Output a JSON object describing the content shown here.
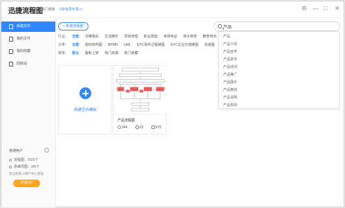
{
  "app": {
    "title": "迅捷流程图",
    "hot_templates": "热门模板",
    "vip_link": "VIP会员专享>>"
  },
  "window_controls": {
    "settings": "⚙",
    "minimize": "—",
    "maximize": "□",
    "close": "✕"
  },
  "sidebar": {
    "items": [
      {
        "label": "新建文件",
        "icon": "new-file-icon",
        "active": true
      },
      {
        "label": "我的文件",
        "icon": "folder-icon",
        "active": false
      },
      {
        "label": "我的收藏",
        "icon": "star-icon",
        "active": false
      },
      {
        "label": "回收站",
        "icon": "trash-icon",
        "active": false
      }
    ],
    "account": {
      "user_type": "普通用户",
      "info_icon": "i",
      "flow_quota": "流程图：0/15个",
      "mindmap_quota": "思维导图：0/5个",
      "links": "登记反馈  ⊙用户中心登陆",
      "upgrade_label": "开通VIP"
    }
  },
  "toolbar": {
    "new_flow_label": "+ 新建流程图"
  },
  "search": {
    "value": "产品"
  },
  "filters": {
    "industry": {
      "label": "行业：",
      "options": [
        "全部",
        "法律相关",
        "生活娱乐",
        "项目管理",
        "职业技能",
        "考研考证",
        "电子商务",
        "教育培训"
      ],
      "selected": 0
    },
    "category": {
      "label": "分类：",
      "options": [
        "全部",
        "组织结构图",
        "BPMN",
        "UML",
        "EPC事件过程链图",
        "EVC企业价值链图",
        "泳道图"
      ],
      "selected": 0
    },
    "sort": {
      "label": "排序：",
      "options": [
        "默认",
        "最新上架",
        "热门商城",
        "热门收藏"
      ],
      "selected": 0
    }
  },
  "suggestions": [
    "产品",
    "产品介绍",
    "产品宣传",
    "产品发布",
    "产品培训",
    "产品推广",
    "产品展示",
    "产品策划",
    "产品说明",
    "产品规划"
  ],
  "new_blank": {
    "label": "新建空白模板"
  },
  "template": {
    "name": "产品流程图",
    "views": "344",
    "likes": "22",
    "price": "¥70"
  },
  "colors": {
    "accent": "#2f88ff",
    "vip": "#ffa51f",
    "node_red": "#e35a5a"
  }
}
